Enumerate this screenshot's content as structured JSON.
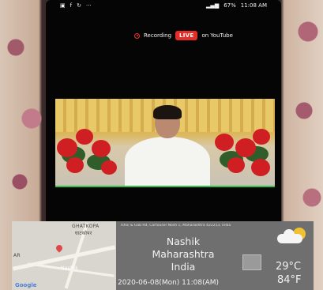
{
  "status_bar": {
    "left_icons": [
      "image-icon",
      "facebook-icon",
      "sync-icon",
      "more-icon"
    ],
    "right_text": "67%",
    "time": "11:08 AM"
  },
  "stream": {
    "recording_label": "Recording",
    "live_label": "LIVE",
    "platform_label": "on YouTube"
  },
  "map": {
    "area_label": "GHATKOPA",
    "area_label_local": "घाटकोपर",
    "pin_label": "Nashik",
    "google_label": "Google",
    "side_letters": "AR"
  },
  "info": {
    "address": "Ishoi & Gab Rd, Cartouser Nosh 1, Maharashtra 422213, India",
    "city": "Nashik",
    "state": "Maharashtra",
    "country": "India",
    "datetime": "2020-06-08(Mon)   11:08(AM)",
    "temp_c": "29°C",
    "temp_f": "84°F"
  },
  "colors": {
    "live_red": "#e52d27",
    "video_border_green": "#2fbf4a",
    "overlay_gray": "#6f6f6f"
  }
}
